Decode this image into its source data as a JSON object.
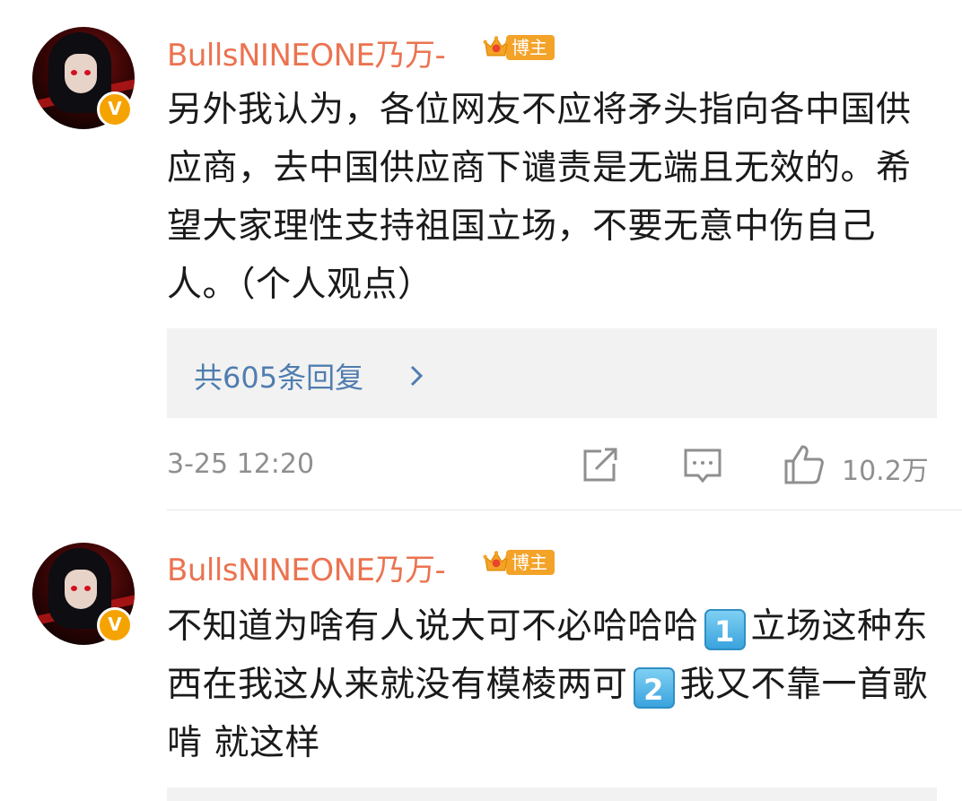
{
  "comments": [
    {
      "username": "BullsNINEONE乃万-",
      "badge_label": "博主",
      "text": "另外我认为，各位网友不应将矛头指向各中国供应商，去中国供应商下谴责是无端且无效的。希望大家理性支持祖国立场，不要无意中伤自己人。（个人观点）",
      "replies_label": "共605条回复",
      "time": "3-25 12:20",
      "likes": "10.2万"
    },
    {
      "username": "BullsNINEONE乃万-",
      "badge_label": "博主",
      "text_parts": [
        "不知道为啥有人说大可不必哈哈哈",
        "立场这种东西在我这从来就没有模棱两可",
        "我又不靠一首歌啃  就这样"
      ],
      "keycap1": "1",
      "keycap2": "2"
    }
  ],
  "icons": {
    "verified": "verified-v-icon",
    "crown": "crown-icon",
    "chevron": "chevron-right-icon",
    "repost": "repost-icon",
    "comment": "comment-icon",
    "like": "thumbs-up-icon"
  },
  "colors": {
    "username": "#eb7350",
    "link": "#507daf",
    "meta": "#8f8f8f",
    "badge": "#f3a328",
    "verified": "#f5a300"
  }
}
